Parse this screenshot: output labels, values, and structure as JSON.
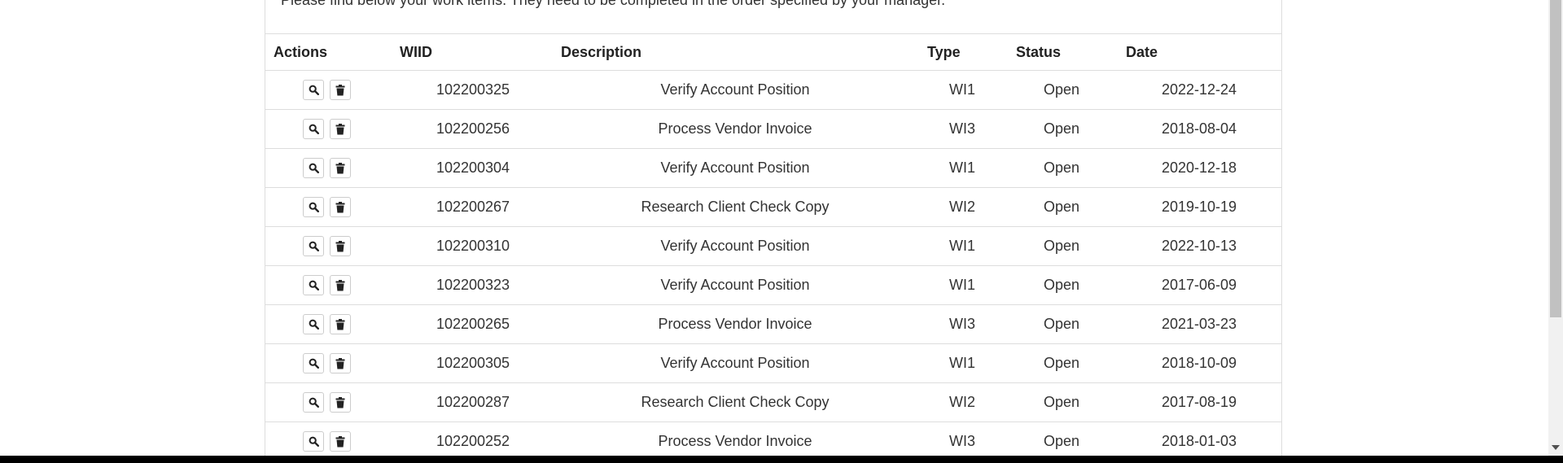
{
  "intro_text": "Please find below your work items. They need to be completed in the order specified by your manager.",
  "table": {
    "headers": {
      "actions": "Actions",
      "wiid": "WIID",
      "description": "Description",
      "type": "Type",
      "status": "Status",
      "date": "Date"
    },
    "rows": [
      {
        "wiid": "102200325",
        "description": "Verify Account Position",
        "type": "WI1",
        "status": "Open",
        "date": "2022-12-24"
      },
      {
        "wiid": "102200256",
        "description": "Process Vendor Invoice",
        "type": "WI3",
        "status": "Open",
        "date": "2018-08-04"
      },
      {
        "wiid": "102200304",
        "description": "Verify Account Position",
        "type": "WI1",
        "status": "Open",
        "date": "2020-12-18"
      },
      {
        "wiid": "102200267",
        "description": "Research Client Check Copy",
        "type": "WI2",
        "status": "Open",
        "date": "2019-10-19"
      },
      {
        "wiid": "102200310",
        "description": "Verify Account Position",
        "type": "WI1",
        "status": "Open",
        "date": "2022-10-13"
      },
      {
        "wiid": "102200323",
        "description": "Verify Account Position",
        "type": "WI1",
        "status": "Open",
        "date": "2017-06-09"
      },
      {
        "wiid": "102200265",
        "description": "Process Vendor Invoice",
        "type": "WI3",
        "status": "Open",
        "date": "2021-03-23"
      },
      {
        "wiid": "102200305",
        "description": "Verify Account Position",
        "type": "WI1",
        "status": "Open",
        "date": "2018-10-09"
      },
      {
        "wiid": "102200287",
        "description": "Research Client Check Copy",
        "type": "WI2",
        "status": "Open",
        "date": "2017-08-19"
      },
      {
        "wiid": "102200252",
        "description": "Process Vendor Invoice",
        "type": "WI3",
        "status": "Open",
        "date": "2018-01-03"
      }
    ]
  },
  "icons": {
    "view": "search-icon",
    "delete": "trash-icon"
  }
}
